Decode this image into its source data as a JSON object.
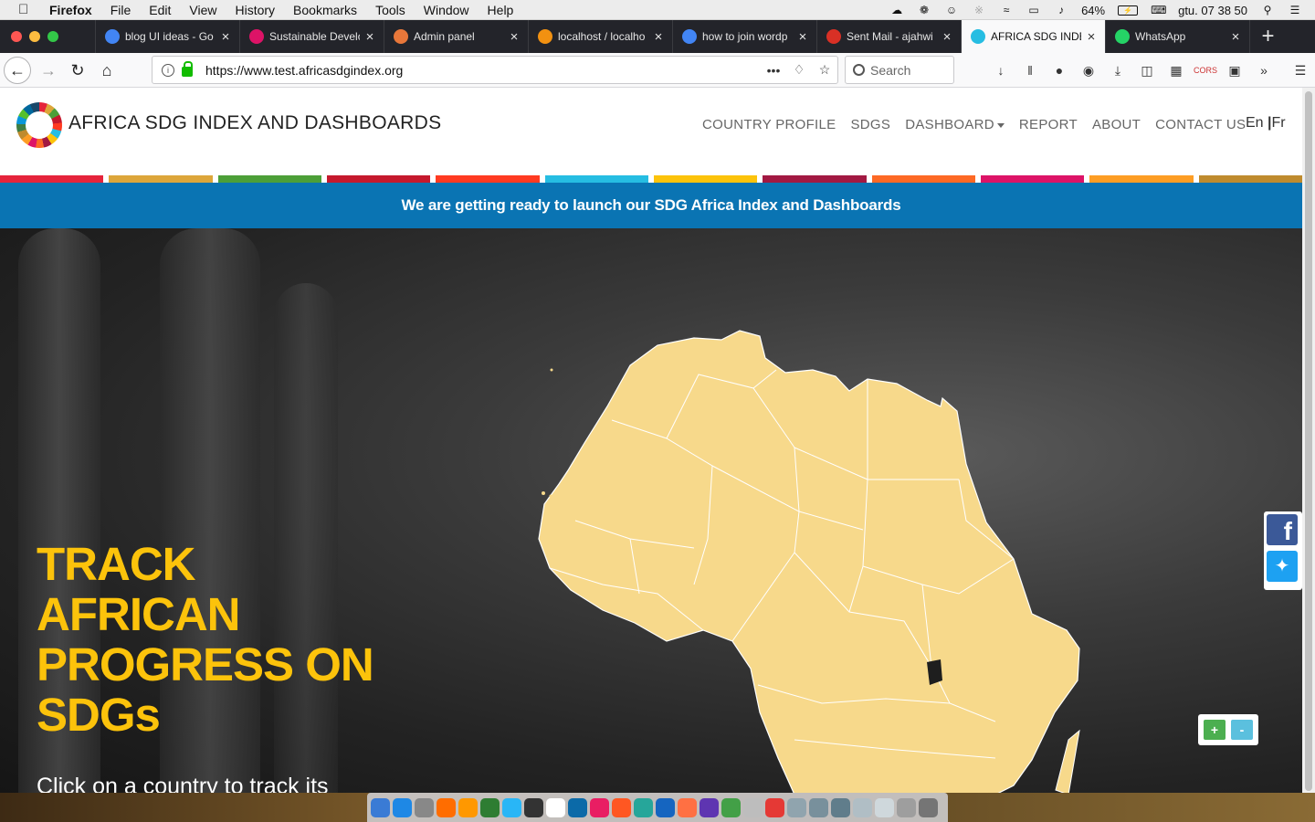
{
  "menubar": {
    "app": "Firefox",
    "items": [
      "File",
      "Edit",
      "View",
      "History",
      "Bookmarks",
      "Tools",
      "Window",
      "Help"
    ],
    "battery": "64%",
    "clock": "gtu. 07 38 50"
  },
  "tabs": [
    {
      "label": "blog UI ideas - Go",
      "icon": "google-icon",
      "color": "#4285f4"
    },
    {
      "label": "Sustainable Develo",
      "icon": "sdg-wheel-icon",
      "color": "#dd1367"
    },
    {
      "label": "Admin panel",
      "icon": "admin-icon",
      "color": "#e8773a"
    },
    {
      "label": "localhost / localho",
      "icon": "phpmyadmin-icon",
      "color": "#f29111"
    },
    {
      "label": "how to join wordp",
      "icon": "google-icon",
      "color": "#4285f4"
    },
    {
      "label": "Sent Mail - ajahwi",
      "icon": "gmail-icon",
      "color": "#d93025"
    },
    {
      "label": "AFRICA SDG INDE",
      "icon": "sdg-wheel-icon",
      "color": "#26bde2",
      "active": true
    },
    {
      "label": "WhatsApp",
      "icon": "whatsapp-icon",
      "color": "#25d366"
    }
  ],
  "toolbar": {
    "url": "https://www.test.africasdgindex.org",
    "search_placeholder": "Search"
  },
  "site": {
    "brand": "AFRICA SDG INDEX AND DASHBOARDS",
    "nav": [
      "COUNTRY PROFILE",
      "SDGS",
      "DASHBOARD",
      "REPORT",
      "ABOUT",
      "CONTACT US"
    ],
    "lang_en": "En",
    "lang_sep": "|",
    "lang_fr": "Fr",
    "stripe_colors": [
      "#e5243b",
      "#dda63a",
      "#4c9f38",
      "#c5192d",
      "#ff3a21",
      "#26bde2",
      "#fcc30b",
      "#a21942",
      "#fd6925",
      "#dd1367",
      "#fd9d24",
      "#bf8b2e"
    ],
    "banner": "We are getting ready to launch our SDG Africa Index and Dashboards",
    "headline": [
      "TRACK",
      "AFRICAN",
      "PROGRESS ON",
      "SDGs"
    ],
    "subtext": "Click on a country to track its",
    "map_fill": "#f7d98b",
    "zoom_in": "+",
    "zoom_out": "-"
  }
}
